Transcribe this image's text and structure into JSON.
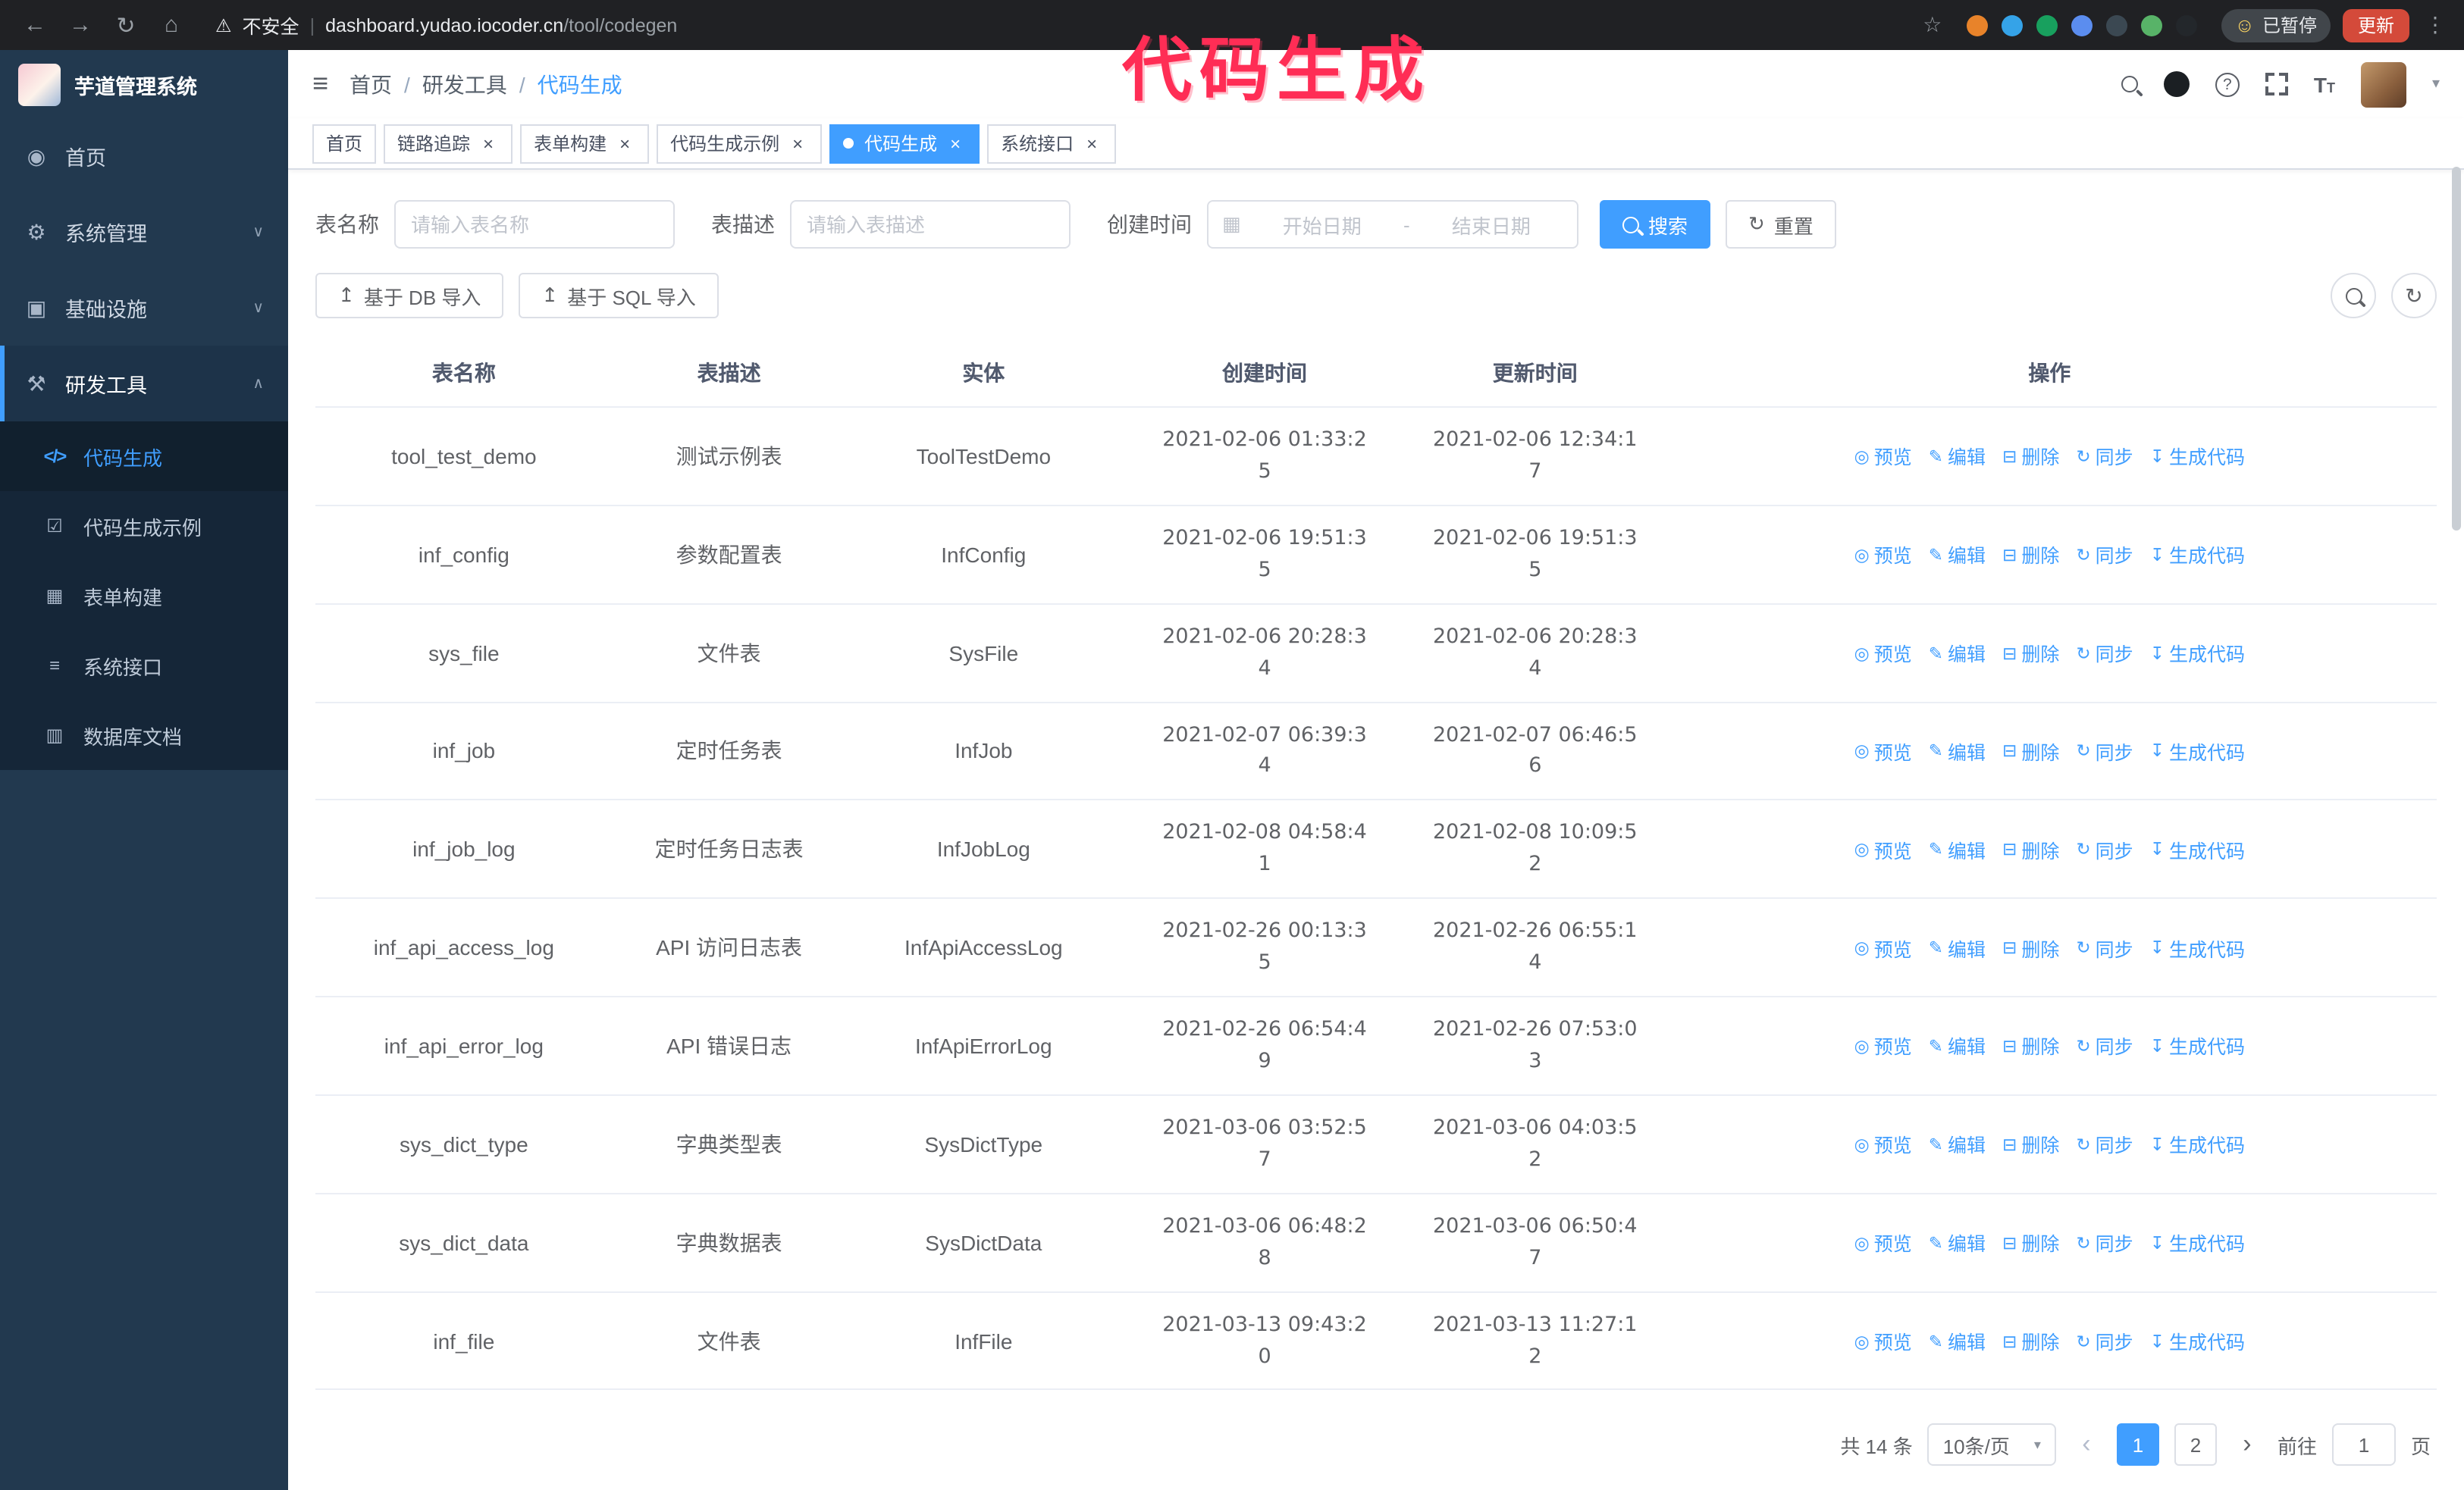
{
  "annotation": {
    "text": "代码生成",
    "color": "#ff2d55"
  },
  "browser": {
    "warning_label": "不安全",
    "url_host": "dashboard.yudao.iocoder.cn",
    "url_path": "/tool/codegen",
    "paused_badge": "已暂停",
    "update_button": "更新",
    "extensions": [
      {
        "key": "shield",
        "color": "#e8832a"
      },
      {
        "key": "drop",
        "color": "#35a3e8"
      },
      {
        "key": "check",
        "color": "#18a05e"
      },
      {
        "key": "people",
        "color": "#5b8def"
      },
      {
        "key": "screen",
        "color": "#3b4852"
      },
      {
        "key": "leaf",
        "color": "#58b368"
      },
      {
        "key": "pug",
        "color": "#23272b"
      }
    ]
  },
  "icons": {
    "back": "←",
    "forward": "→",
    "reload": "↻",
    "home": "⌂",
    "warning": "⚠",
    "star": "☆",
    "kebab": "⋮",
    "divider": "|",
    "emoji": "☺",
    "dashboard": "◉",
    "gear": "⚙",
    "infra": "▣",
    "tools": "⚒",
    "code": "</>",
    "sample": "☑",
    "form": "▦",
    "api": "≡",
    "docs": "▥",
    "chevron_down": "∨",
    "chevron_up": "∧",
    "hamburger": "≡",
    "question": "?",
    "caret_down": "▾",
    "close": "×",
    "calendar": "▦",
    "refresh": "↻",
    "upload": "↥",
    "eye": "◎",
    "edit": "✎",
    "trash": "⊟",
    "sync": "↻",
    "download": "↧",
    "fontsize_large": "T",
    "fontsize_small": "T"
  },
  "sidebar": {
    "logo_title": "芋道管理系统",
    "items": [
      {
        "key": "home",
        "label": "首页",
        "icon": "dashboard"
      },
      {
        "key": "system",
        "label": "系统管理",
        "icon": "gear",
        "chevron": "down"
      },
      {
        "key": "infra",
        "label": "基础设施",
        "icon": "infra",
        "chevron": "down"
      },
      {
        "key": "devtools",
        "label": "研发工具",
        "icon": "tools",
        "chevron": "up",
        "expanded": true
      }
    ],
    "subitems": [
      {
        "key": "codegen",
        "label": "代码生成",
        "icon": "code",
        "active": true
      },
      {
        "key": "codegen-demo",
        "label": "代码生成示例",
        "icon": "sample"
      },
      {
        "key": "form-builder",
        "label": "表单构建",
        "icon": "form"
      },
      {
        "key": "api",
        "label": "系统接口",
        "icon": "api"
      },
      {
        "key": "db-doc",
        "label": "数据库文档",
        "icon": "docs"
      }
    ]
  },
  "header": {
    "separator": "/",
    "breadcrumb": [
      {
        "key": "home",
        "label": "首页"
      },
      {
        "key": "devtools",
        "label": "研发工具"
      },
      {
        "key": "codegen",
        "label": "代码生成",
        "current": true
      }
    ]
  },
  "tabs": [
    {
      "key": "home",
      "label": "首页"
    },
    {
      "key": "tracer",
      "label": "链路追踪",
      "closable": true
    },
    {
      "key": "form-builder",
      "label": "表单构建",
      "closable": true
    },
    {
      "key": "codegen-demo",
      "label": "代码生成示例",
      "closable": true
    },
    {
      "key": "codegen",
      "label": "代码生成",
      "closable": true,
      "active": true
    },
    {
      "key": "api",
      "label": "系统接口",
      "closable": true
    }
  ],
  "filters": {
    "table_name_label": "表名称",
    "table_name_placeholder": "请输入表名称",
    "table_desc_label": "表描述",
    "table_desc_placeholder": "请输入表描述",
    "create_time_label": "创建时间",
    "start_date_placeholder": "开始日期",
    "end_date_placeholder": "结束日期",
    "range_separator": "-",
    "search_button": "搜索",
    "reset_button": "重置"
  },
  "toolbar": {
    "import_db_button": "基于 DB 导入",
    "import_sql_button": "基于 SQL 导入"
  },
  "table": {
    "columns": [
      {
        "key": "table-name",
        "label": "表名称"
      },
      {
        "key": "table-desc",
        "label": "表描述"
      },
      {
        "key": "entity",
        "label": "实体"
      },
      {
        "key": "created-time",
        "label": "创建时间"
      },
      {
        "key": "updated-time",
        "label": "更新时间"
      },
      {
        "key": "actions",
        "label": "操作"
      }
    ],
    "actions": [
      {
        "key": "preview",
        "label": "预览",
        "icon": "eye"
      },
      {
        "key": "edit",
        "label": "编辑",
        "icon": "edit"
      },
      {
        "key": "delete",
        "label": "删除",
        "icon": "trash"
      },
      {
        "key": "sync",
        "label": "同步",
        "icon": "sync"
      },
      {
        "key": "generate-code",
        "label": "生成代码",
        "icon": "download"
      }
    ],
    "rows": [
      {
        "name": "tool_test_demo",
        "desc": "测试示例表",
        "entity": "ToolTestDemo",
        "created": "2021-02-06 01:33:25",
        "updated": "2021-02-06 12:34:17"
      },
      {
        "name": "inf_config",
        "desc": "参数配置表",
        "entity": "InfConfig",
        "created": "2021-02-06 19:51:35",
        "updated": "2021-02-06 19:51:35"
      },
      {
        "name": "sys_file",
        "desc": "文件表",
        "entity": "SysFile",
        "created": "2021-02-06 20:28:34",
        "updated": "2021-02-06 20:28:34"
      },
      {
        "name": "inf_job",
        "desc": "定时任务表",
        "entity": "InfJob",
        "created": "2021-02-07 06:39:34",
        "updated": "2021-02-07 06:46:56"
      },
      {
        "name": "inf_job_log",
        "desc": "定时任务日志表",
        "entity": "InfJobLog",
        "created": "2021-02-08 04:58:41",
        "updated": "2021-02-08 10:09:52"
      },
      {
        "name": "inf_api_access_log",
        "desc": "API 访问日志表",
        "entity": "InfApiAccessLog",
        "created": "2021-02-26 00:13:35",
        "updated": "2021-02-26 06:55:14"
      },
      {
        "name": "inf_api_error_log",
        "desc": "API 错误日志",
        "entity": "InfApiErrorLog",
        "created": "2021-02-26 06:54:49",
        "updated": "2021-02-26 07:53:03"
      },
      {
        "name": "sys_dict_type",
        "desc": "字典类型表",
        "entity": "SysDictType",
        "created": "2021-03-06 03:52:57",
        "updated": "2021-03-06 04:03:52"
      },
      {
        "name": "sys_dict_data",
        "desc": "字典数据表",
        "entity": "SysDictData",
        "created": "2021-03-06 06:48:28",
        "updated": "2021-03-06 06:50:47"
      },
      {
        "name": "inf_file",
        "desc": "文件表",
        "entity": "InfFile",
        "created": "2021-03-13 09:43:20",
        "updated": "2021-03-13 11:27:12"
      }
    ]
  },
  "pagination": {
    "total": "共 14 条",
    "page_size": "10条/页",
    "prev": "‹",
    "next": "›",
    "pages": [
      "1",
      "2"
    ],
    "active_page": "1",
    "goto_label": "前往",
    "goto_value": "1",
    "unit_label": "页"
  }
}
